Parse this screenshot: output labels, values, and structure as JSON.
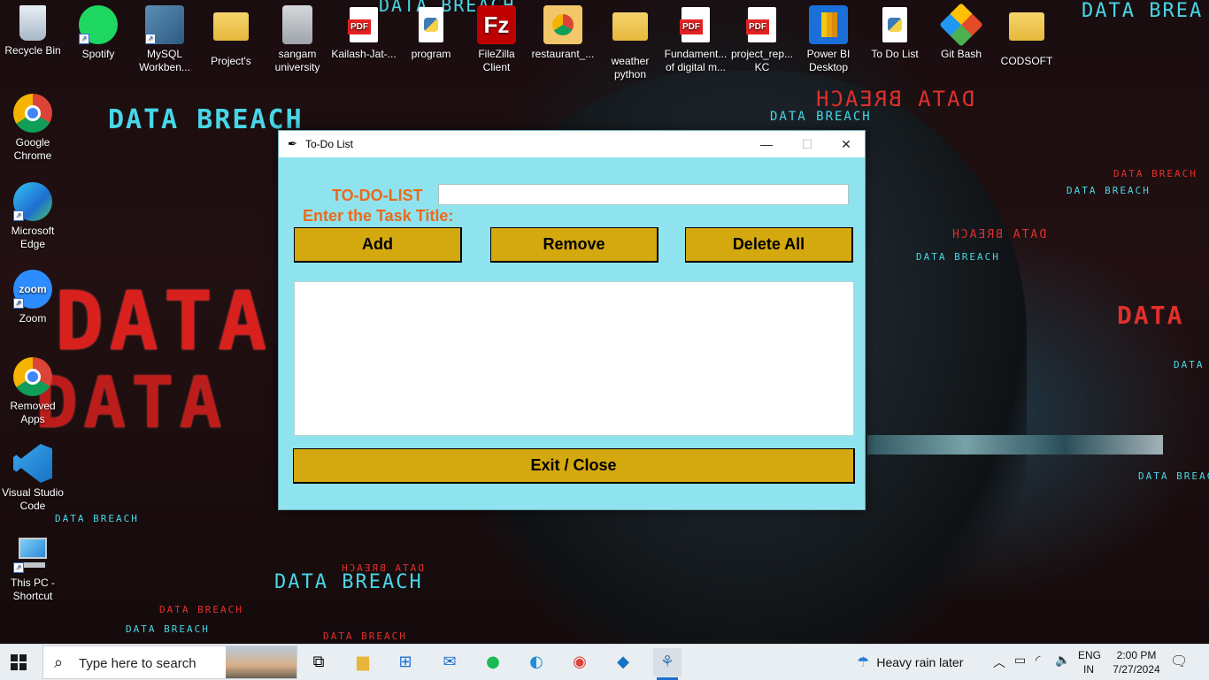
{
  "desktop": {
    "icons": [
      {
        "label": "Recycle Bin",
        "icon": "recycle-bin-icon"
      },
      {
        "label": "Spotify",
        "icon": "spotify-icon"
      },
      {
        "label": "MySQL Workben...",
        "icon": "mysql-workbench-icon"
      },
      {
        "label": "Project's",
        "icon": "folder-icon"
      },
      {
        "label": "sangam university",
        "icon": "document-icon"
      },
      {
        "label": "Kailash-Jat-...",
        "icon": "pdf-icon"
      },
      {
        "label": "program",
        "icon": "python-file-icon"
      },
      {
        "label": "FileZilla Client",
        "icon": "filezilla-icon"
      },
      {
        "label": "restaurant_...",
        "icon": "chrome-file-icon"
      },
      {
        "label": "weather python",
        "icon": "folder-icon"
      },
      {
        "label": "Fundament... of digital m...",
        "icon": "pdf-icon"
      },
      {
        "label": "project_rep... KC",
        "icon": "pdf-icon"
      },
      {
        "label": "Power BI Desktop",
        "icon": "power-bi-icon"
      },
      {
        "label": "To Do List",
        "icon": "python-file-icon"
      },
      {
        "label": "Git Bash",
        "icon": "git-bash-icon"
      },
      {
        "label": "CODSOFT",
        "icon": "folder-icon"
      },
      {
        "label": "Google Chrome",
        "icon": "chrome-icon"
      },
      {
        "label": "Microsoft Edge",
        "icon": "edge-icon"
      },
      {
        "label": "Zoom",
        "icon": "zoom-icon"
      },
      {
        "label": "Removed Apps",
        "icon": "chrome-icon"
      },
      {
        "label": "Visual Studio Code",
        "icon": "vscode-icon"
      },
      {
        "label": "This PC - Shortcut",
        "icon": "this-pc-icon"
      }
    ],
    "wallpaper_text": {
      "data_breach": "DATA BREACH",
      "data": "DATA",
      "data_b": "DATA B",
      "data_breach_top": "DATA BREACH",
      "data_brea": "DATA BREA"
    }
  },
  "window": {
    "title": "To-Do List",
    "heading": "TO-DO-LIST",
    "prompt": "Enter the Task Title:",
    "entry_value": "",
    "buttons": {
      "add": "Add",
      "remove": "Remove",
      "delete_all": "Delete All",
      "exit": "Exit / Close"
    },
    "tasks": [],
    "colors": {
      "background": "#8fe3ee",
      "button": "#d4a80f",
      "label": "#ec6a1c"
    }
  },
  "taskbar": {
    "search_placeholder": "Type here to search",
    "weather": "Heavy rain later",
    "language": "ENG",
    "region": "IN",
    "time": "2:00 PM",
    "date": "7/27/2024"
  }
}
